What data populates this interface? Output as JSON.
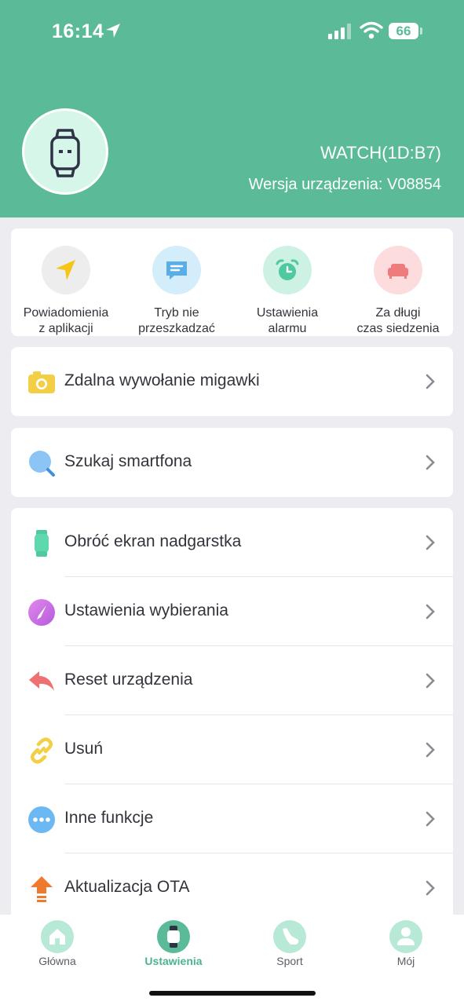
{
  "status_bar": {
    "time": "16:14",
    "battery": "66"
  },
  "device": {
    "name": "WATCH(1D:B7)",
    "version": "Wersja urządzenia: V08854"
  },
  "quick_actions": [
    {
      "line1": "Powiadomienia",
      "line2": "z aplikacji",
      "icon": "send-arrow-icon",
      "bg": "#ededed",
      "fg": "#f5c518"
    },
    {
      "line1": "Tryb nie",
      "line2": "przeszkadzać",
      "icon": "message-icon",
      "bg": "#d3edfb",
      "fg": "#5aaee8"
    },
    {
      "line1": "Ustawienia",
      "line2": "alarmu",
      "icon": "alarm-clock-icon",
      "bg": "#cdf2e4",
      "fg": "#4ec9a0"
    },
    {
      "line1": "Za długi",
      "line2": "czas siedzenia",
      "icon": "sofa-icon",
      "bg": "#fcdcdc",
      "fg": "#ef7c7c"
    }
  ],
  "rows": {
    "shutter": "Zdalna wywołanie migawki",
    "find_phone": "Szukaj smartfona",
    "rotate": "Obróć ekran nadgarstka",
    "dial": "Ustawienia wybierania",
    "reset": "Reset urządzenia",
    "remove": "Usuń",
    "other": "Inne funkcje",
    "ota": "Aktualizacja OTA"
  },
  "tabs": [
    {
      "label": "Główna",
      "icon": "home-icon",
      "active": false
    },
    {
      "label": "Ustawienia",
      "icon": "watch-icon",
      "active": true
    },
    {
      "label": "Sport",
      "icon": "sneaker-icon",
      "active": false
    },
    {
      "label": "Mój",
      "icon": "user-icon",
      "active": false
    }
  ],
  "colors": {
    "brand": "#5bbb98",
    "background": "#ededf1",
    "tab_active": "#4db38d"
  }
}
